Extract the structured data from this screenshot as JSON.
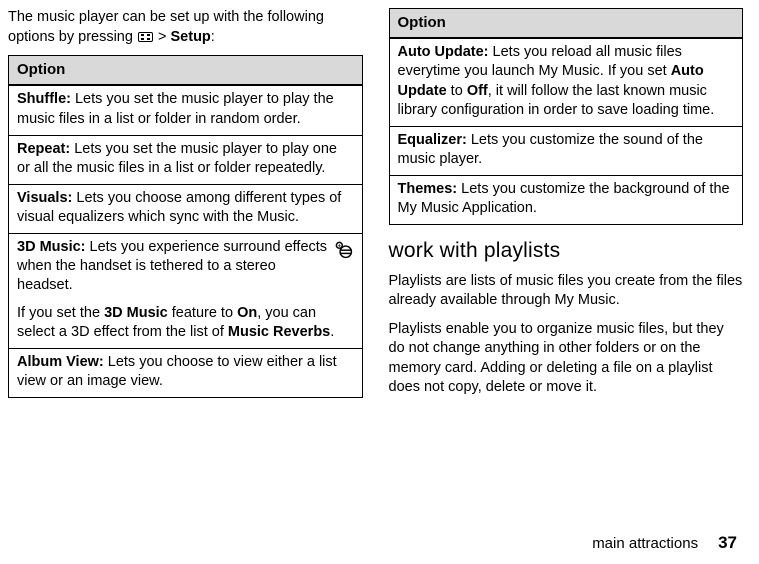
{
  "intro": {
    "pre": "The music player can be set up with the following options by pressing ",
    "gt": " > ",
    "setup": "Setup",
    "colon": ":"
  },
  "table_header": "Option",
  "left_options": [
    {
      "label": "Shuffle:",
      "desc": " Lets you set the music player to play the music files in a list or folder in random order."
    },
    {
      "label": "Repeat:",
      "desc": " Lets you set the music player to play one or all the music files in a list or folder repeatedly."
    },
    {
      "label": "Visuals:",
      "desc": " Lets you choose among different types of visual equalizers which sync with the Music."
    }
  ],
  "threeD": {
    "label": "3D Music:",
    "desc": " Lets you experience surround effects when the handset is tethered to a stereo headset.",
    "p2a": "If you set the ",
    "p2b": "3D Music",
    "p2c": " feature to ",
    "p2d": "On",
    "p2e": ", you can select a 3D effect from the list of ",
    "p2f": "Music Reverbs",
    "p2g": "."
  },
  "album": {
    "label": "Album View:",
    "desc": " Lets you choose to view either a list view or an image view."
  },
  "right_options": {
    "auto": {
      "label": "Auto Update:",
      "d1": " Lets you reload all music files everytime you launch My Music. If you set ",
      "d2": "Auto Update",
      "d3": " to ",
      "d4": "Off",
      "d5": ", it will follow the last known music library configuration in order to save loading time."
    },
    "eq": {
      "label": "Equalizer:",
      "desc": " Lets you customize the sound of the music player."
    },
    "themes": {
      "label": "Themes:",
      "desc": " Lets you customize the background of the My Music Application."
    }
  },
  "section_heading": "work with playlists",
  "para1": "Playlists are lists of music files you create from the files already available through My Music.",
  "para2": "Playlists enable you to organize music files, but they do not change anything in other folders or on the memory card. Adding or deleting a file on a playlist does not copy, delete or move it.",
  "footer": {
    "section": "main attractions",
    "page": "37"
  }
}
